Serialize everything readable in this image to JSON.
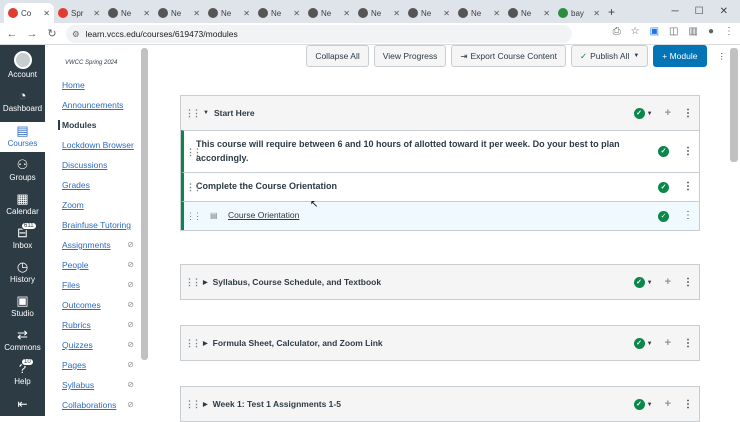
{
  "browser": {
    "tabs": [
      {
        "label": "Co",
        "color": "#e03c31",
        "active": true
      },
      {
        "label": "Spr",
        "color": "#e03c31"
      },
      {
        "label": "Ne",
        "color": "#444"
      },
      {
        "label": "Ne",
        "color": "#444"
      },
      {
        "label": "Ne",
        "color": "#444"
      },
      {
        "label": "Ne",
        "color": "#444"
      },
      {
        "label": "Ne",
        "color": "#444"
      },
      {
        "label": "Ne",
        "color": "#444"
      },
      {
        "label": "Ne",
        "color": "#444"
      },
      {
        "label": "Ne",
        "color": "#444"
      },
      {
        "label": "Ne",
        "color": "#444"
      },
      {
        "label": "bay",
        "color": "#2a8f3c"
      }
    ],
    "url": "learn.vccs.edu/courses/619473/modules"
  },
  "global_nav": {
    "items": [
      {
        "label": "Account",
        "icon": "account-icon"
      },
      {
        "label": "Dashboard",
        "icon": "dashboard-icon"
      },
      {
        "label": "Courses",
        "icon": "courses-icon",
        "active": true
      },
      {
        "label": "Groups",
        "icon": "groups-icon"
      },
      {
        "label": "Calendar",
        "icon": "calendar-icon"
      },
      {
        "label": "Inbox",
        "icon": "inbox-icon",
        "badge": "611"
      },
      {
        "label": "History",
        "icon": "history-icon"
      },
      {
        "label": "Studio",
        "icon": "studio-icon"
      },
      {
        "label": "Commons",
        "icon": "commons-icon"
      },
      {
        "label": "Help",
        "icon": "help-icon",
        "badge": "10"
      }
    ]
  },
  "course_nav": {
    "term": "VWCC Spring 2024",
    "items": [
      "Home",
      "Announcements",
      "Modules",
      "Lockdown Browser",
      "Discussions",
      "Grades",
      "Zoom",
      "Brainfuse Tutoring",
      "Assignments",
      "People",
      "Files",
      "Outcomes",
      "Rubrics",
      "Quizzes",
      "Pages",
      "Syllabus",
      "Collaborations"
    ]
  },
  "toolbar": {
    "collapse_all": "Collapse All",
    "view_progress": "View Progress",
    "export": "Export Course Content",
    "publish_all": "Publish All",
    "module": "+ Module"
  },
  "modules": [
    {
      "title": "Start Here",
      "items": [
        "This course will require between 6 and 10 hours of allotted toward it per week. Do your best to plan accordingly.",
        "Complete the Course Orientation"
      ],
      "sub": "Course Orientation"
    },
    {
      "title": "Syllabus, Course Schedule, and Textbook"
    },
    {
      "title": "Formula Sheet, Calculator, and Zoom Link"
    },
    {
      "title": "Week 1: Test 1 Assignments 1-5"
    }
  ]
}
